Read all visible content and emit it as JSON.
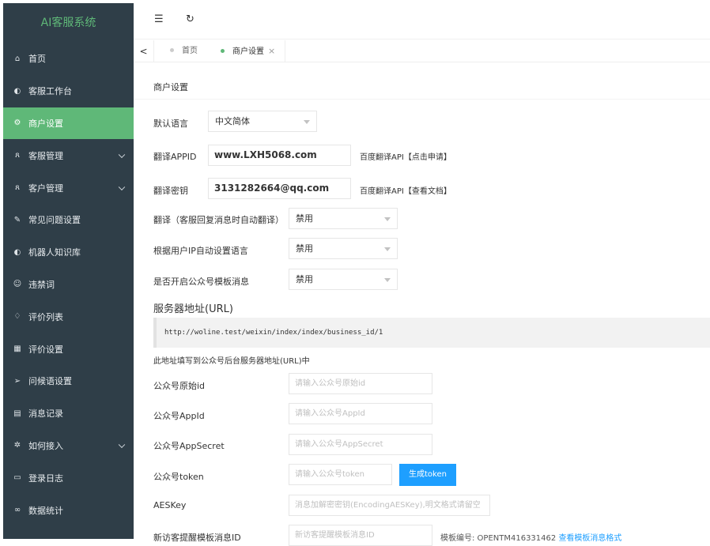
{
  "app": {
    "title": "AI客服系统"
  },
  "sidebar": {
    "items": [
      {
        "label": "首页",
        "icon": "home-icon",
        "glyph": "⌂",
        "expandable": false,
        "active": false
      },
      {
        "label": "客服工作台",
        "icon": "headset-icon",
        "glyph": "◐",
        "expandable": false,
        "active": false
      },
      {
        "label": "商户设置",
        "icon": "gear-icon",
        "glyph": "⚙",
        "expandable": false,
        "active": true
      },
      {
        "label": "客服管理",
        "icon": "user-icon",
        "glyph": "ጸ",
        "expandable": true,
        "active": false
      },
      {
        "label": "客户管理",
        "icon": "users-icon",
        "glyph": "ጸ",
        "expandable": true,
        "active": false
      },
      {
        "label": "常见问题设置",
        "icon": "edit-icon",
        "glyph": "✎",
        "expandable": false,
        "active": false
      },
      {
        "label": "机器人知识库",
        "icon": "robot-icon",
        "glyph": "◐",
        "expandable": false,
        "active": false
      },
      {
        "label": "违禁词",
        "icon": "face-icon",
        "glyph": "☺",
        "expandable": false,
        "active": false
      },
      {
        "label": "评价列表",
        "icon": "thumbs-up-icon",
        "glyph": "♢",
        "expandable": false,
        "active": false
      },
      {
        "label": "评价设置",
        "icon": "calendar-icon",
        "glyph": "▦",
        "expandable": false,
        "active": false
      },
      {
        "label": "问候语设置",
        "icon": "send-icon",
        "glyph": "➢",
        "expandable": false,
        "active": false
      },
      {
        "label": "消息记录",
        "icon": "log-icon",
        "glyph": "▤",
        "expandable": false,
        "active": false
      },
      {
        "label": "如何接入",
        "icon": "plugin-icon",
        "glyph": "✲",
        "expandable": true,
        "active": false
      },
      {
        "label": "登录日志",
        "icon": "window-icon",
        "glyph": "▭",
        "expandable": false,
        "active": false
      },
      {
        "label": "数据统计",
        "icon": "chart-icon",
        "glyph": "∞",
        "expandable": false,
        "active": false
      }
    ]
  },
  "topbar": {
    "menu_glyph": "☰",
    "refresh_glyph": "↻"
  },
  "tabs": {
    "back_glyph": "<",
    "home": "首页",
    "current": "商户设置",
    "close_glyph": "×"
  },
  "page": {
    "title": "商户设置",
    "default_language": {
      "label": "默认语言",
      "value": "中文简体"
    },
    "translate_appid": {
      "label": "翻译APPID",
      "value": "www.LXH5068.com",
      "helper": "百度翻译API【点击申请】"
    },
    "translate_key": {
      "label": "翻译密钥",
      "value": "3131282664@qq.com",
      "helper": "百度翻译API【查看文档】"
    },
    "auto_translate": {
      "label": "翻译（客服回复消息时自动翻译）",
      "value": "禁用"
    },
    "ip_language": {
      "label": "根据用户IP自动设置语言",
      "value": "禁用"
    },
    "template_msg": {
      "label": "是否开启公众号模板消息",
      "value": "禁用"
    },
    "server_url": {
      "title": "服务器地址(URL)",
      "url": "http://woline.test/weixin/index/index/business_id/1",
      "note": "此地址填写到公众号后台服务器地址(URL)中"
    },
    "mp_original_id": {
      "label": "公众号原始id",
      "placeholder": "请输入公众号原始id"
    },
    "mp_appid": {
      "label": "公众号AppId",
      "placeholder": "请输入公众号AppId"
    },
    "mp_appsecret": {
      "label": "公众号AppSecret",
      "placeholder": "请输入公众号AppSecret"
    },
    "mp_token": {
      "label": "公众号token",
      "placeholder": "请输入公众号token",
      "button": "生成token"
    },
    "aeskey": {
      "label": "AESKey",
      "placeholder": "消息加解密密钥(EncodingAESKey),明文格式请留空"
    },
    "visitor_template": {
      "label": "新访客提醒模板消息ID",
      "placeholder": "新访客提醒模板消息ID",
      "code_text": "模板编号: OPENTM416331462",
      "link": "查看模板消息格式"
    }
  },
  "colors": {
    "sidebar_bg": "#2f3e48",
    "accent_green": "#5fb878",
    "link_blue": "#1e9fff"
  }
}
